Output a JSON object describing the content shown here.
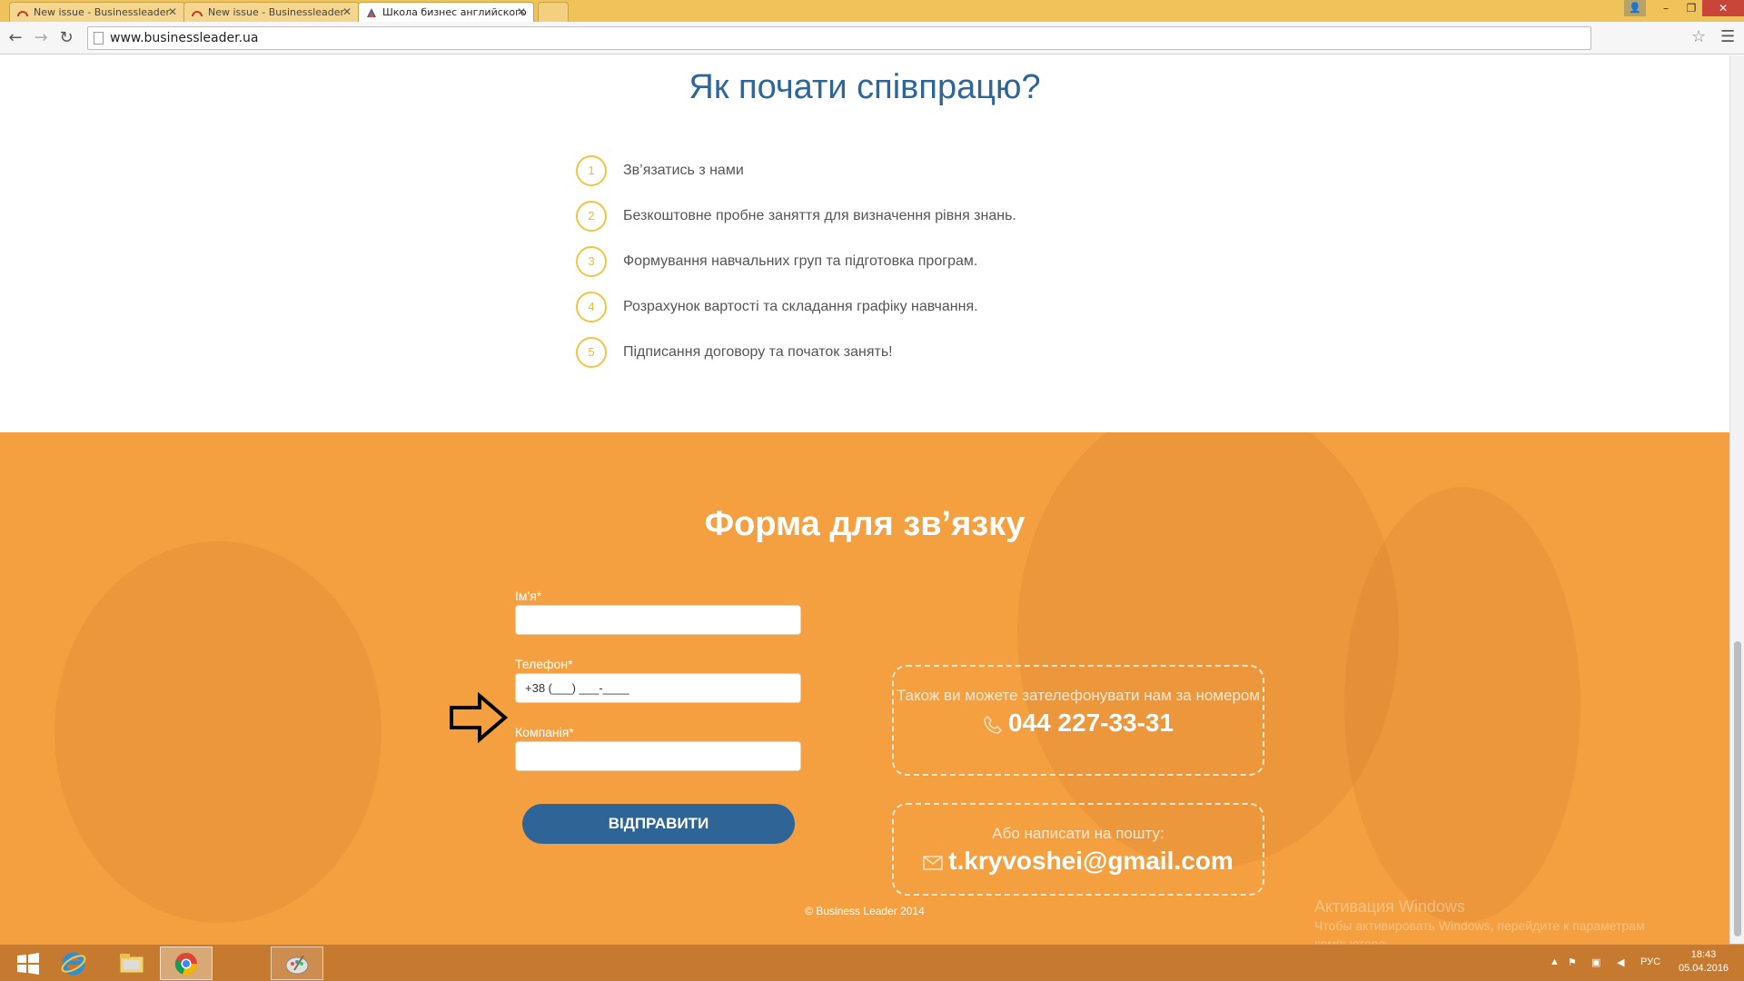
{
  "browser": {
    "tabs": [
      {
        "title": "New issue - Businessleader",
        "active": false
      },
      {
        "title": "New issue - Businessleader",
        "active": false
      },
      {
        "title": "Школа бизнес английского",
        "active": true
      }
    ],
    "url": "www.businessleader.ua"
  },
  "steps_section": {
    "title": "Як почати співпрацю?",
    "steps": [
      {
        "num": "1",
        "text": "Зв’язатись з нами"
      },
      {
        "num": "2",
        "text": "Безкоштовне пробне заняття для визначення рівня знань."
      },
      {
        "num": "3",
        "text": "Формування навчальних груп та підготовка програм."
      },
      {
        "num": "4",
        "text": "Розрахунок вартості та складання графіку навчання."
      },
      {
        "num": "5",
        "text": "Підписання договору та початок занять!"
      }
    ]
  },
  "contact_form": {
    "title": "Форма для зв’язку",
    "name_label": "Ім'я*",
    "name_value": "",
    "phone_label": "Телефон*",
    "phone_value": "+38 (___) ___-____",
    "company_label": "Компанія*",
    "company_value": "",
    "submit_label": "ВІДПРАВИТИ"
  },
  "contact_info": {
    "phone_text": "Також ви можете зателефонувати нам за номером",
    "phone": "044 227-33-31",
    "email_text": "Або написати на пошту:",
    "email": "t.kryvoshei@gmail.com"
  },
  "footer": {
    "copyright": "© Business Leader 2014"
  },
  "watermark": {
    "title": "Активация Windows",
    "text": "Чтобы активировать Windows, перейдите к параметрам компьютера."
  },
  "taskbar": {
    "language": "РУС",
    "time": "18:43",
    "date": "05.04.2016"
  },
  "colors": {
    "accent_blue": "#2f6699",
    "orange": "#f5a040",
    "step_circle": "#f3c343"
  }
}
